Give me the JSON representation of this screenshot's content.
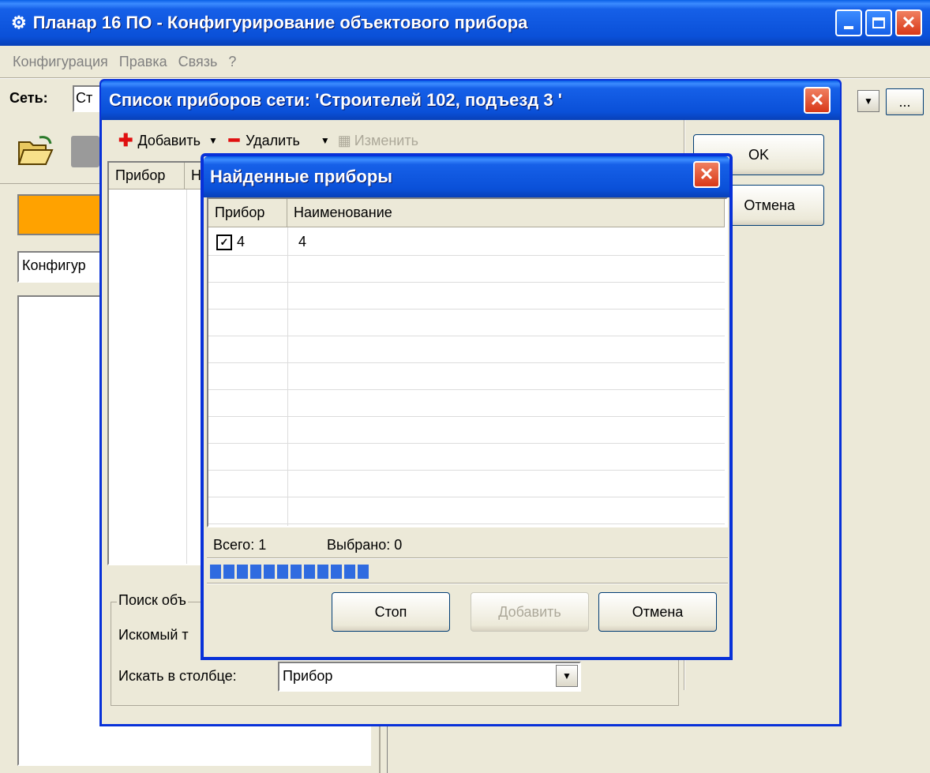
{
  "main_window": {
    "title": "Планар 16 ПО - Конфигурирование объектового прибора",
    "menu": [
      "Конфигурация",
      "Правка",
      "Связь",
      "?"
    ],
    "network_label": "Сеть:",
    "network_value_partial": "Ст",
    "config_field_partial": "Конфигур",
    "browse_label": "..."
  },
  "device_list_dialog": {
    "title": "Список приборов сети: 'Строителей 102, подъезд 3 '",
    "toolbar": {
      "add": "Добавить",
      "delete": "Удалить",
      "edit": "Изменить"
    },
    "column_pribor": "Прибор",
    "column_partial": "Н",
    "ok": "OK",
    "cancel": "Отмена",
    "search_group": "Поиск объ",
    "search_text_label": "Искомый т",
    "search_column_label": "Искать в столбце:",
    "search_column_value": "Прибор"
  },
  "found_dialog": {
    "title": "Найденные приборы",
    "columns": [
      "Прибор",
      "Наименование"
    ],
    "rows": [
      {
        "checked": true,
        "device": "4",
        "name": "4"
      }
    ],
    "total_label": "Всего: 1",
    "selected_label": "Выбрано: 0",
    "progress_blocks": 12,
    "buttons": {
      "stop": "Стоп",
      "add": "Добавить",
      "cancel": "Отмена"
    }
  }
}
